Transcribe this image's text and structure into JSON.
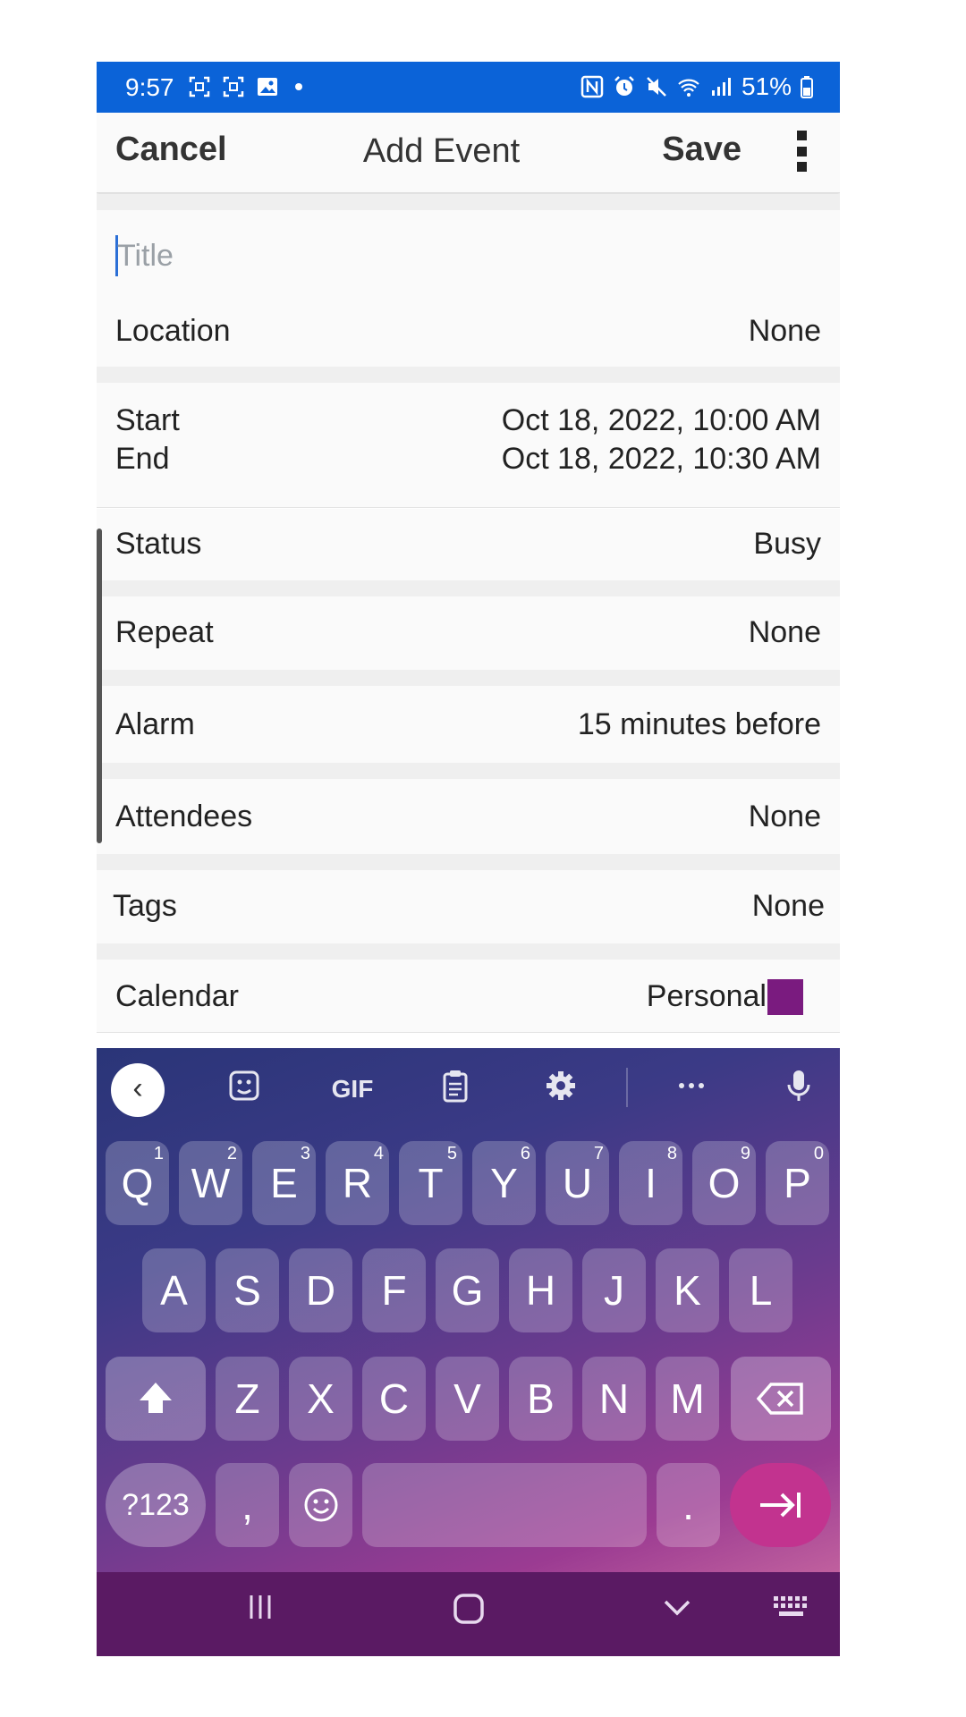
{
  "status_bar": {
    "time": "9:57",
    "battery": "51%"
  },
  "header": {
    "cancel": "Cancel",
    "title": "Add Event",
    "save": "Save"
  },
  "title_field": {
    "placeholder": "Title",
    "value": ""
  },
  "location": {
    "label": "Location",
    "value": "None"
  },
  "start": {
    "label": "Start",
    "value": "Oct 18, 2022, 10:00 AM"
  },
  "end": {
    "label": "End",
    "value": "Oct 18, 2022, 10:30 AM"
  },
  "status": {
    "label": "Status",
    "value": "Busy"
  },
  "repeat": {
    "label": "Repeat",
    "value": "None"
  },
  "alarm": {
    "label": "Alarm",
    "value": "15 minutes before"
  },
  "attendees": {
    "label": "Attendees",
    "value": "None"
  },
  "tags": {
    "label": "Tags",
    "value": "None"
  },
  "calendar": {
    "label": "Calendar",
    "value": "Personal",
    "color": "#7a1b7f"
  },
  "keyboard": {
    "toolbar": {
      "gif": "GIF"
    },
    "row1": [
      {
        "key": "Q",
        "num": "1"
      },
      {
        "key": "W",
        "num": "2"
      },
      {
        "key": "E",
        "num": "3"
      },
      {
        "key": "R",
        "num": "4"
      },
      {
        "key": "T",
        "num": "5"
      },
      {
        "key": "Y",
        "num": "6"
      },
      {
        "key": "U",
        "num": "7"
      },
      {
        "key": "I",
        "num": "8"
      },
      {
        "key": "O",
        "num": "9"
      },
      {
        "key": "P",
        "num": "0"
      }
    ],
    "row2": [
      "A",
      "S",
      "D",
      "F",
      "G",
      "H",
      "J",
      "K",
      "L"
    ],
    "row3": [
      "Z",
      "X",
      "C",
      "V",
      "B",
      "N",
      "M"
    ],
    "sym": "?123",
    "comma": ",",
    "period": "."
  },
  "colors": {
    "status_bar": "#0b63d8",
    "nav_bar": "#5a1a63",
    "enter_key": "#c2338f"
  }
}
